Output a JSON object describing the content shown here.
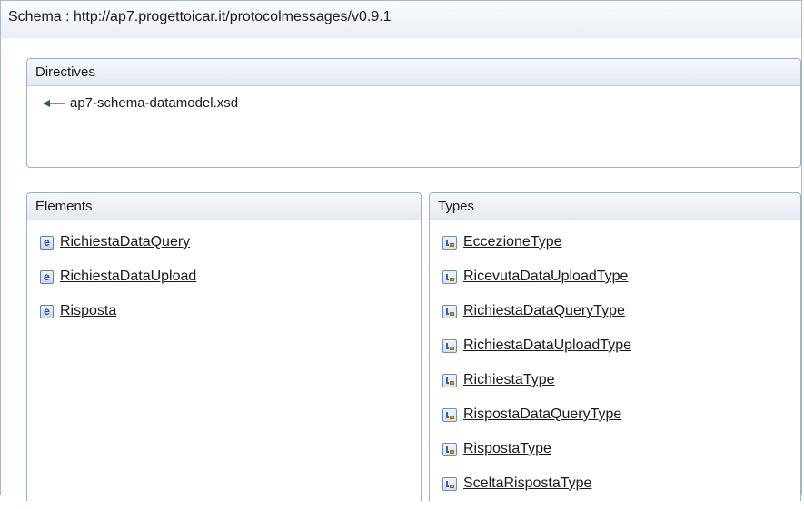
{
  "schema": {
    "title": "Schema : http://ap7.progettoicar.it/protocolmessages/v0.9.1"
  },
  "directives": {
    "header": "Directives",
    "items": [
      {
        "label": "ap7-schema-datamodel.xsd",
        "icon": "import-arrow-icon"
      }
    ]
  },
  "elements": {
    "header": "Elements",
    "items": [
      {
        "label": "RichiestaDataQuery",
        "icon": "element-icon"
      },
      {
        "label": "RichiestaDataUpload",
        "icon": "element-icon"
      },
      {
        "label": "Risposta",
        "icon": "element-icon"
      }
    ]
  },
  "types": {
    "header": "Types",
    "items": [
      {
        "label": "EccezioneType",
        "icon": "complex-type-icon"
      },
      {
        "label": "RicevutaDataUploadType",
        "icon": "complex-type-icon"
      },
      {
        "label": "RichiestaDataQueryType",
        "icon": "complex-type-icon"
      },
      {
        "label": "RichiestaDataUploadType",
        "icon": "complex-type-icon"
      },
      {
        "label": "RichiestaType",
        "icon": "complex-type-icon"
      },
      {
        "label": "RispostaDataQueryType",
        "icon": "complex-type-icon"
      },
      {
        "label": "RispostaType",
        "icon": "complex-type-icon"
      },
      {
        "label": "SceltaRispostaType",
        "icon": "complex-type-icon"
      }
    ]
  },
  "icons": {
    "element_letter": "e"
  },
  "colors": {
    "border": "#9eb0c8",
    "header_bg": "#e4eaf3",
    "icon_blue": "#23479a"
  }
}
